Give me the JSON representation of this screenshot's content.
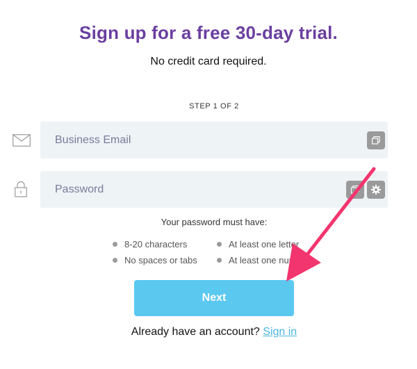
{
  "header": {
    "title": "Sign up for a free 30-day trial.",
    "subtitle": "No credit card required."
  },
  "step": "STEP 1 OF 2",
  "form": {
    "email": {
      "placeholder": "Business Email",
      "value": "",
      "icon": "envelope-icon"
    },
    "password": {
      "placeholder": "Password",
      "value": "",
      "icon": "lock-icon"
    }
  },
  "requirements": {
    "title": "Your password must have:",
    "items": [
      "8-20 characters",
      "At least one letter",
      "No spaces or tabs",
      "At least one number"
    ]
  },
  "next_label": "Next",
  "signin": {
    "prompt": "Already have an account?",
    "link": "Sign in"
  },
  "colors": {
    "title": "#6a3fa0",
    "button": "#5bc8f0",
    "link": "#4ab6e0",
    "field_bg": "#eef3f6",
    "arrow": "#f2356e"
  }
}
